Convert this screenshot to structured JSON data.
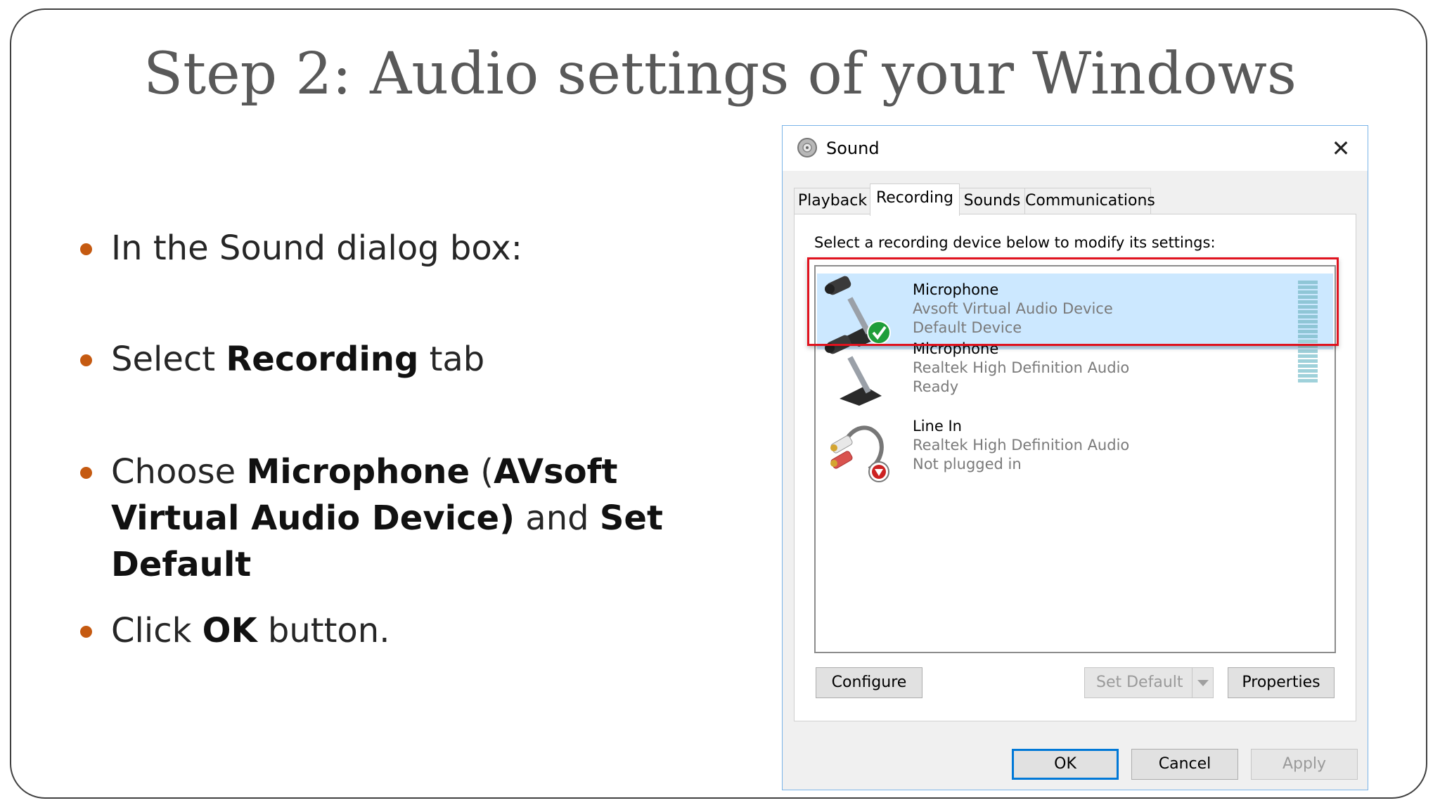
{
  "slide": {
    "title": "Step 2: Audio settings of your Windows",
    "bullets": [
      {
        "parts": [
          {
            "t": "In the Sound dialog box:",
            "b": false
          }
        ]
      },
      {
        "parts": [
          {
            "t": "Select ",
            "b": false
          },
          {
            "t": "Recording",
            "b": true
          },
          {
            "t": " tab",
            "b": false
          }
        ]
      },
      {
        "parts": [
          {
            "t": "Choose ",
            "b": false
          },
          {
            "t": "Microphone",
            "b": true
          },
          {
            "t": " (",
            "b": false
          },
          {
            "t": "AVsoft Virtual Audio Device)",
            "b": true
          },
          {
            "t": " and ",
            "b": false
          },
          {
            "t": "Set Default",
            "b": true
          }
        ]
      },
      {
        "parts": [
          {
            "t": "Click ",
            "b": false
          },
          {
            "t": "OK",
            "b": true
          },
          {
            "t": " button.",
            "b": false
          }
        ]
      }
    ]
  },
  "dialog": {
    "title": "Sound",
    "close_label": "✕",
    "tabs": [
      "Playback",
      "Recording",
      "Sounds",
      "Communications"
    ],
    "active_tab": "Recording",
    "instruction": "Select a recording device below to modify its settings:",
    "devices": [
      {
        "name": "Microphone",
        "description": "Avsoft Virtual Audio Device",
        "status": "Default Device",
        "icon": "microphone-icon",
        "badge": "default-check-icon",
        "selected": true
      },
      {
        "name": "Microphone",
        "description": "Realtek High Definition Audio",
        "status": "Ready",
        "icon": "microphone-icon",
        "badge": null,
        "selected": false
      },
      {
        "name": "Line In",
        "description": "Realtek High Definition Audio",
        "status": "Not plugged in",
        "icon": "line-in-jack-icon",
        "badge": "unplugged-arrow-icon",
        "selected": false
      }
    ],
    "buttons": {
      "configure": "Configure",
      "set_default": "Set Default",
      "properties": "Properties",
      "ok": "OK",
      "cancel": "Cancel",
      "apply": "Apply"
    }
  },
  "colors": {
    "bullet_accent": "#c55a11",
    "highlight_box": "#e0131f",
    "selection": "#cce8ff",
    "primary_button_border": "#0078d7"
  }
}
